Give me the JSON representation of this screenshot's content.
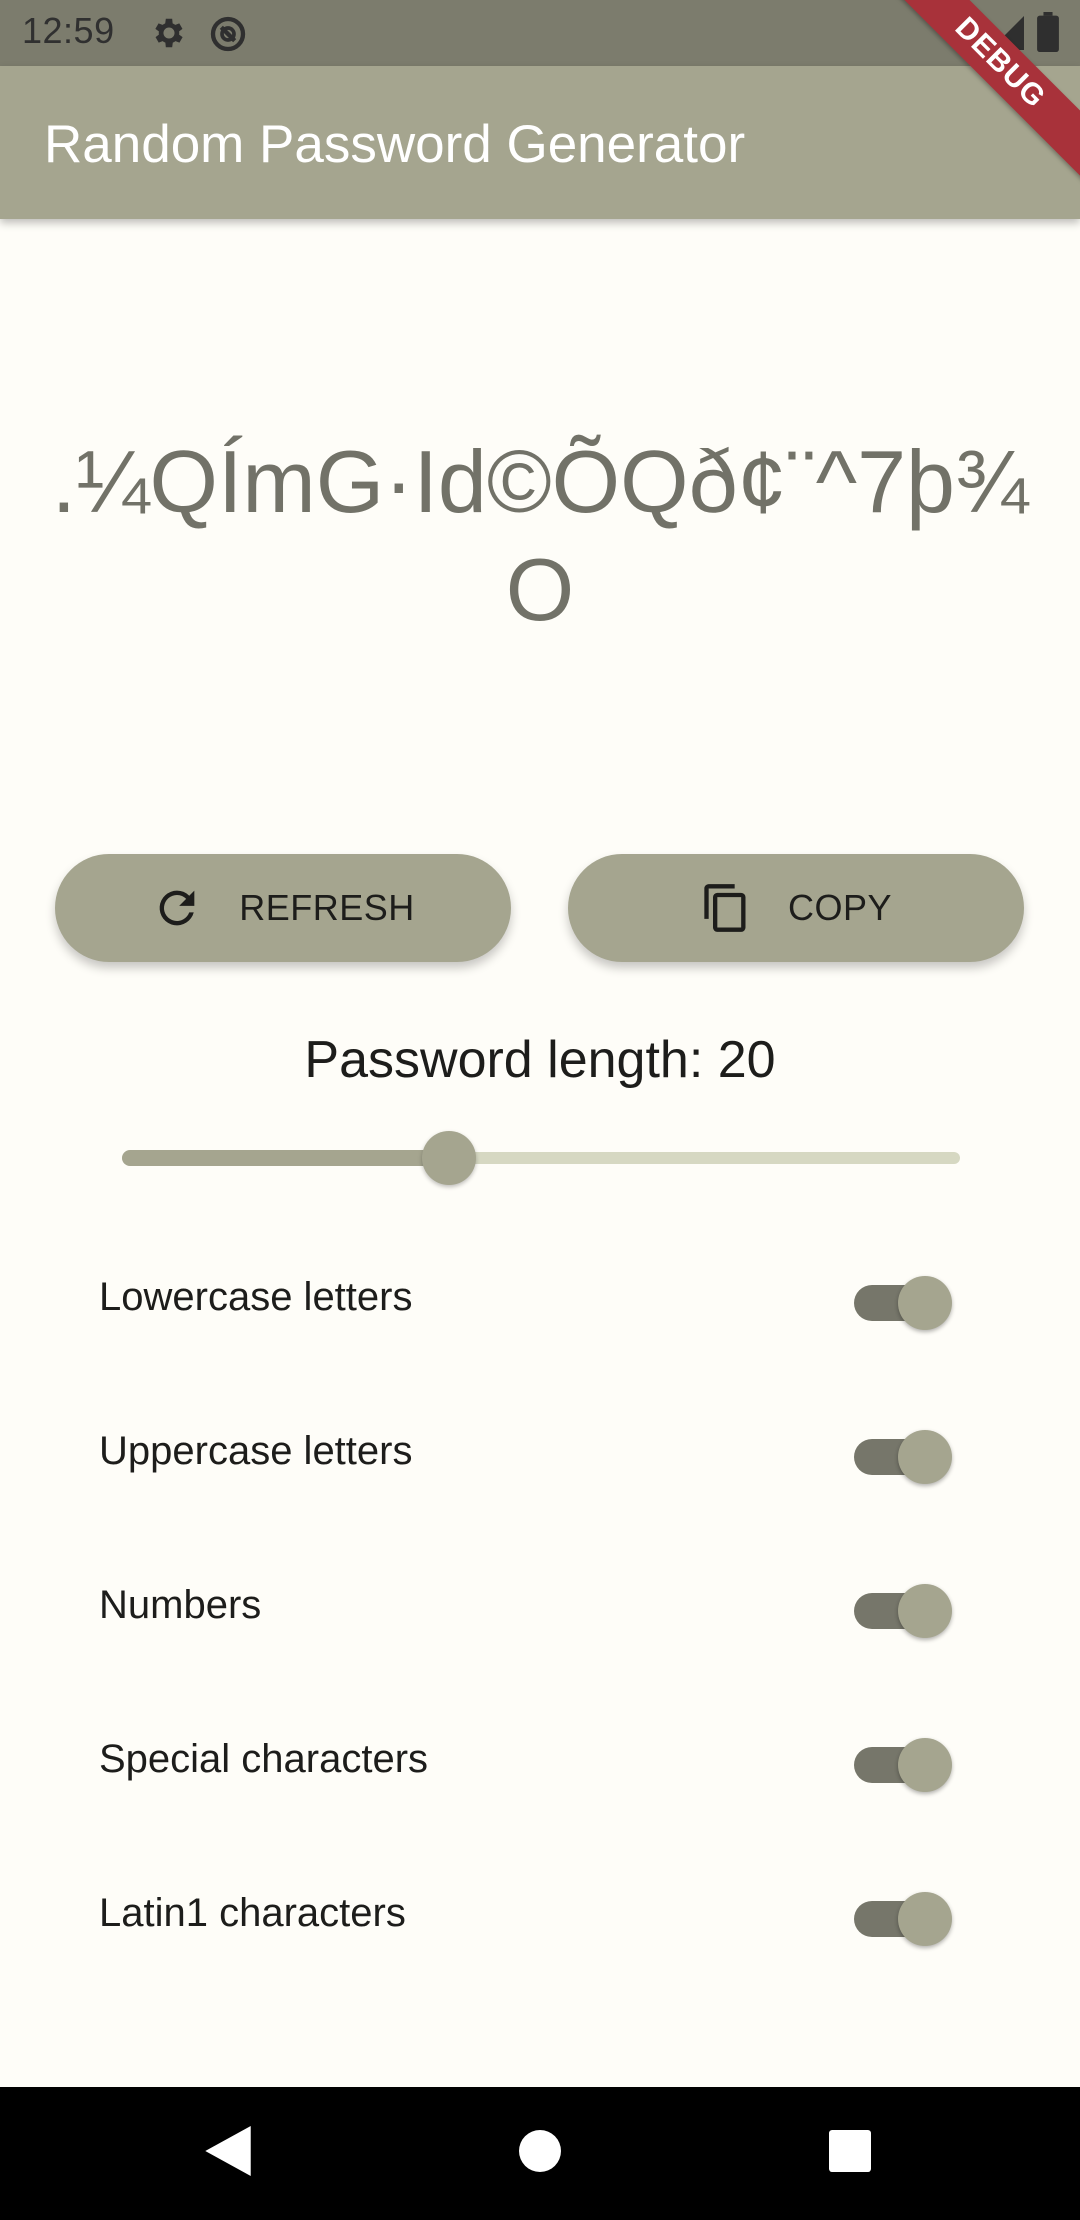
{
  "status_bar": {
    "time": "12:59",
    "icons": [
      "gear-icon",
      "data-saver-icon",
      "wifi-icon",
      "signal-icon",
      "battery-icon"
    ]
  },
  "debug_banner": "DEBUG",
  "app_bar": {
    "title": "Random Password Generator"
  },
  "password": {
    "value": ".¼QÍmG·Id©ÕQð¢¨^7þ¾O"
  },
  "buttons": {
    "refresh_label": "REFRESH",
    "refresh_icon": "refresh-icon",
    "copy_label": "COPY",
    "copy_icon": "copy-icon"
  },
  "length": {
    "label": "Password length: 20",
    "value": 20,
    "slider_fraction": 0.39
  },
  "options": [
    {
      "label": "Lowercase letters",
      "enabled": true
    },
    {
      "label": "Uppercase letters",
      "enabled": true
    },
    {
      "label": "Numbers",
      "enabled": true
    },
    {
      "label": "Special characters",
      "enabled": true
    },
    {
      "label": "Latin1 characters",
      "enabled": true
    }
  ],
  "nav_bar": {
    "icons": [
      "back-icon",
      "home-icon",
      "recents-icon"
    ]
  },
  "colors": {
    "primary": "#a5a58f",
    "background": "#fefdf8",
    "switch_track": "#76766a",
    "status_bar": "#7c7c6d",
    "password_text": "#727268",
    "debug_banner": "#a8323a"
  }
}
